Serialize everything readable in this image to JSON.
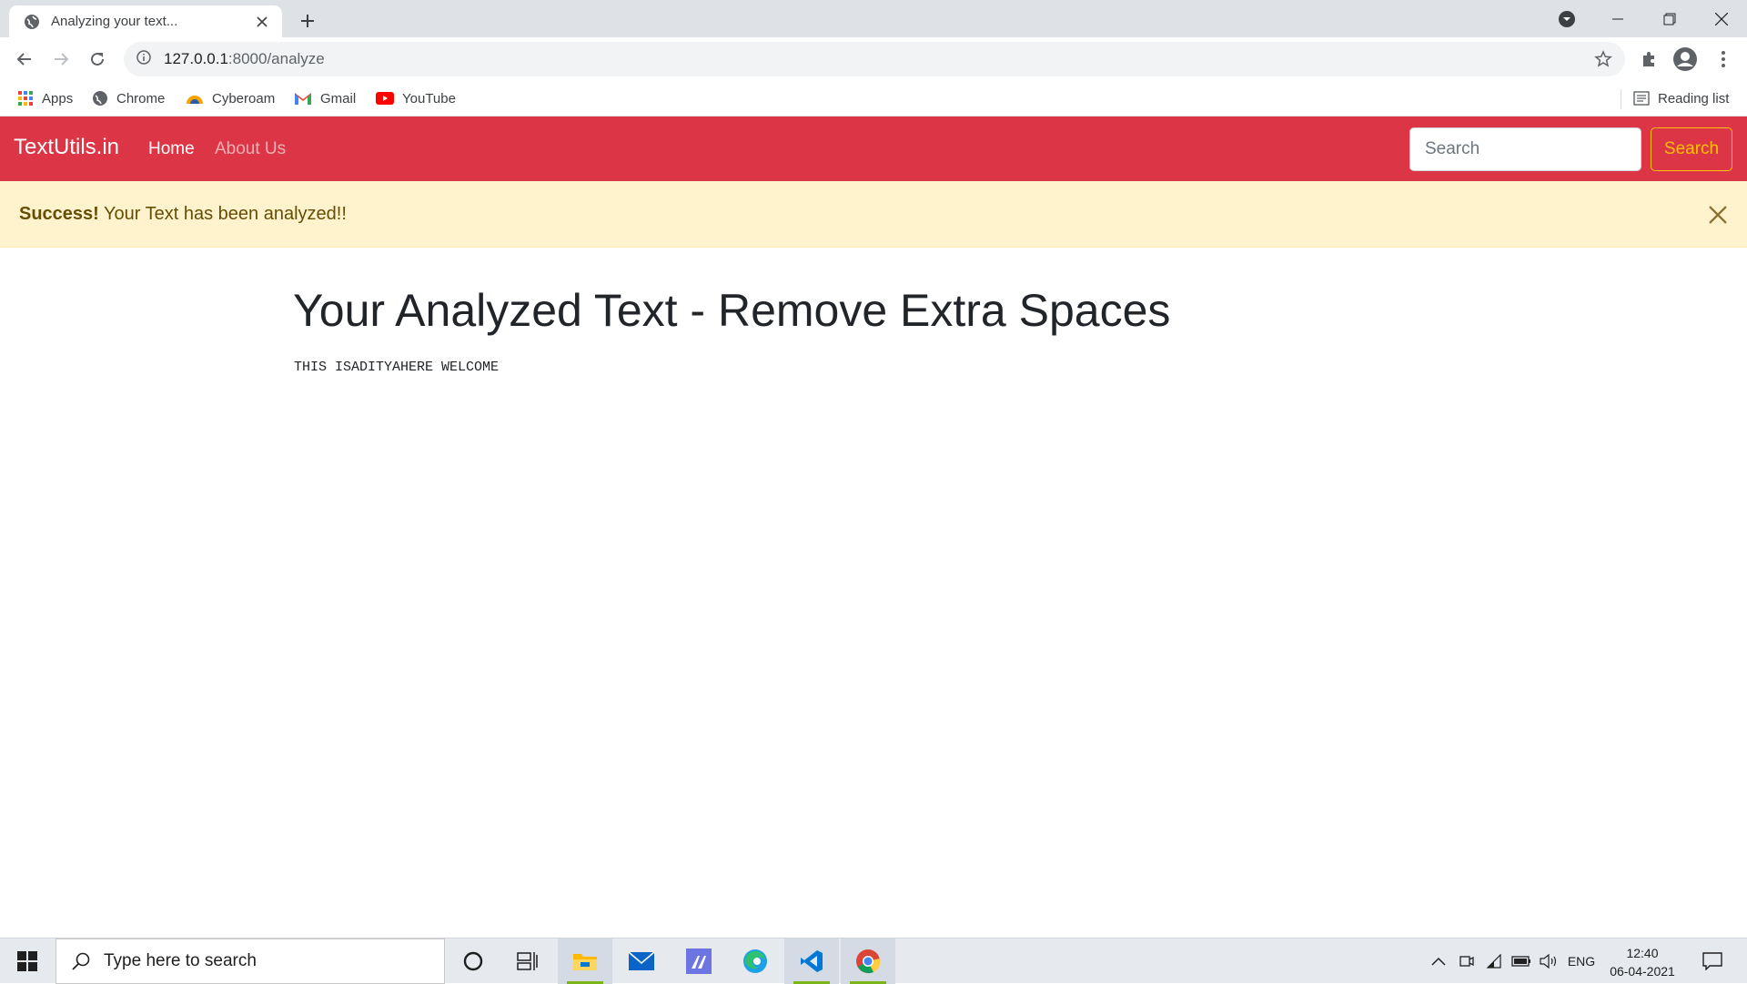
{
  "browser": {
    "tab_title": "Analyzing your text...",
    "url_host": "127.0.0.1",
    "url_path": ":8000/analyze",
    "bookmarks": [
      "Apps",
      "Chrome",
      "Cyberoam",
      "Gmail",
      "YouTube"
    ],
    "reading_list": "Reading list"
  },
  "navbar": {
    "brand": "TextUtils.in",
    "links": [
      "Home",
      "About Us"
    ],
    "search_placeholder": "Search",
    "search_button": "Search",
    "bg_color": "#dc3545"
  },
  "alert": {
    "strong": "Success!",
    "message": " Your Text has been analyzed!!"
  },
  "content": {
    "heading": "Your Analyzed Text - Remove Extra Spaces",
    "result_text": "THIS ISADITYAHERE WELCOME"
  },
  "taskbar": {
    "search_placeholder": "Type here to search",
    "apps": [
      "cortana-icon",
      "task-view-icon",
      "file-explorer-icon",
      "mail-icon",
      "app-icon",
      "edge-icon",
      "vscode-icon",
      "chrome-icon"
    ],
    "language": "ENG",
    "time": "12:40",
    "date": "06-04-2021"
  }
}
